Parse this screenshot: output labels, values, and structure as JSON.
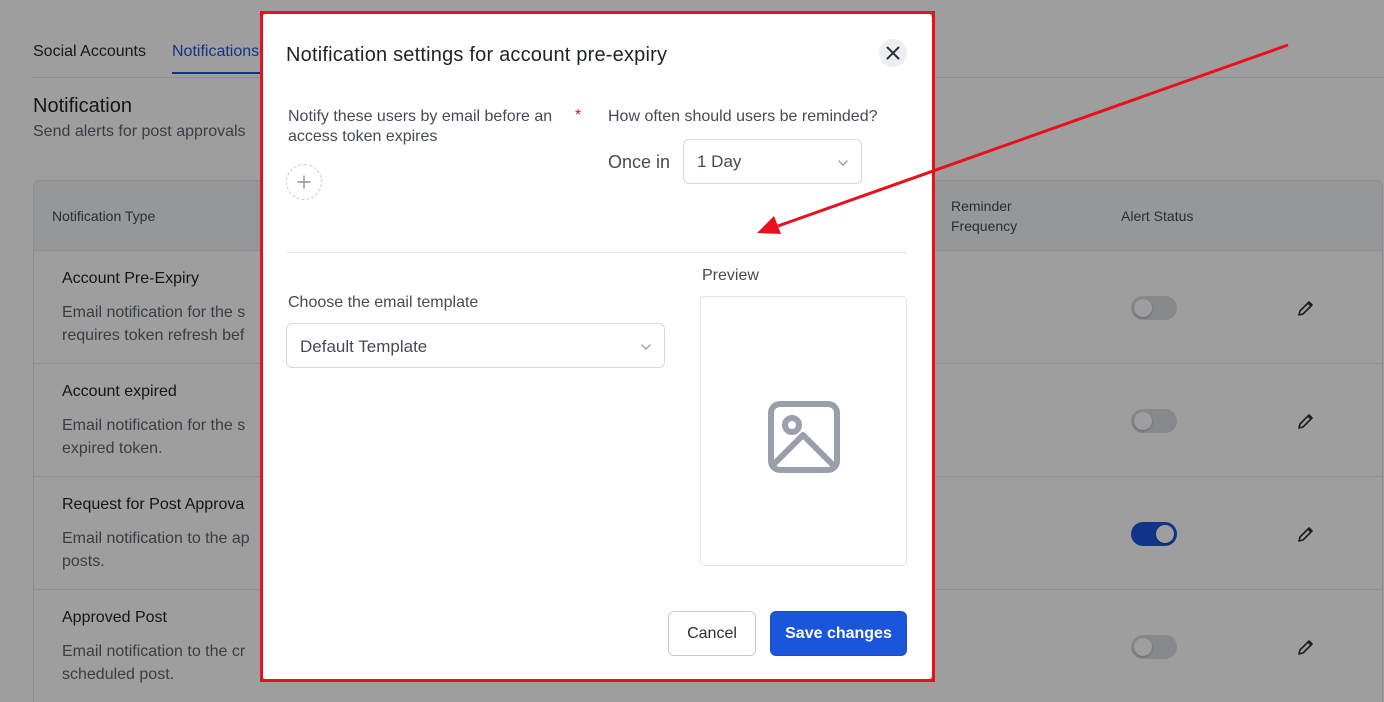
{
  "tabs": [
    {
      "label": "Social Accounts"
    },
    {
      "label": "Notifications"
    }
  ],
  "section": {
    "title": "Notification",
    "subtitle": "Send alerts for post approvals"
  },
  "table": {
    "headers": {
      "type": "Notification Type",
      "frequency": "Reminder Frequency",
      "status": "Alert Status"
    },
    "rows": [
      {
        "title": "Account Pre-Expiry",
        "desc": "Email notification for the s requires token refresh bef",
        "enabled": false
      },
      {
        "title": "Account expired",
        "desc": "Email notification for the s expired token.",
        "enabled": false
      },
      {
        "title": "Request for Post Approva",
        "desc": "Email notification to the ap posts.",
        "enabled": true
      },
      {
        "title": "Approved Post",
        "desc": "Email notification to the cr scheduled post.",
        "enabled": false
      }
    ]
  },
  "modal": {
    "title": "Notification settings for account pre-expiry",
    "notify_label": "Notify these users by email before an access token expires",
    "required_mark": "*",
    "frequency_label": "How often should users be reminded?",
    "once_label": "Once in",
    "frequency_value": "1 Day",
    "template_label": "Choose the email template",
    "template_value": "Default Template",
    "preview_label": "Preview",
    "cancel_label": "Cancel",
    "save_label": "Save changes"
  },
  "icons": {
    "close": "close-icon",
    "add": "plus-icon",
    "dropdown": "chevron-down-icon",
    "preview": "image-placeholder-icon",
    "edit": "pencil-icon"
  },
  "colors": {
    "accent": "#1a56db",
    "highlight": "#e8101c",
    "toggle_off": "#d9dbe0"
  }
}
